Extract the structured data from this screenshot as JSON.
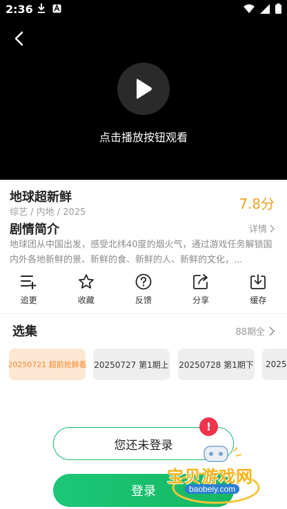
{
  "status_bar": {
    "time": "2:36"
  },
  "player": {
    "play_hint": "点击播放按钮观看"
  },
  "show": {
    "title": "地球超新鲜",
    "meta": "综艺 / 内地 / 2025",
    "score": "7.8分"
  },
  "synopsis": {
    "heading": "剧情简介",
    "detail_label": "详情",
    "text": "地球团从中国出发，感受北纬40度的烟火气，通过游戏任务解锁国内外各地新鲜的景、新鲜的食、新鲜的人、新鲜的文化，..."
  },
  "actions": [
    {
      "label": "追更",
      "icon": "add-list-icon"
    },
    {
      "label": "收藏",
      "icon": "star-icon"
    },
    {
      "label": "反馈",
      "icon": "question-icon"
    },
    {
      "label": "分享",
      "icon": "share-icon"
    },
    {
      "label": "缓存",
      "icon": "download-icon"
    }
  ],
  "episodes": {
    "heading": "选集",
    "count_label": "88期全",
    "items": [
      {
        "label": "20250721 超前抢鲜看",
        "active": true
      },
      {
        "label": "20250727 第1期上",
        "active": false
      },
      {
        "label": "20250728 第1期下",
        "active": false
      },
      {
        "label": "2025",
        "active": false
      }
    ]
  },
  "login": {
    "prompt": "您还未登录",
    "badge": "!",
    "button": "登录"
  },
  "watermark": {
    "text": "宝贝游戏网",
    "url": "baobeiy.com"
  },
  "colors": {
    "accent_green": "#16b763",
    "score_orange": "#f0a023",
    "badge_red": "#f0334a"
  }
}
